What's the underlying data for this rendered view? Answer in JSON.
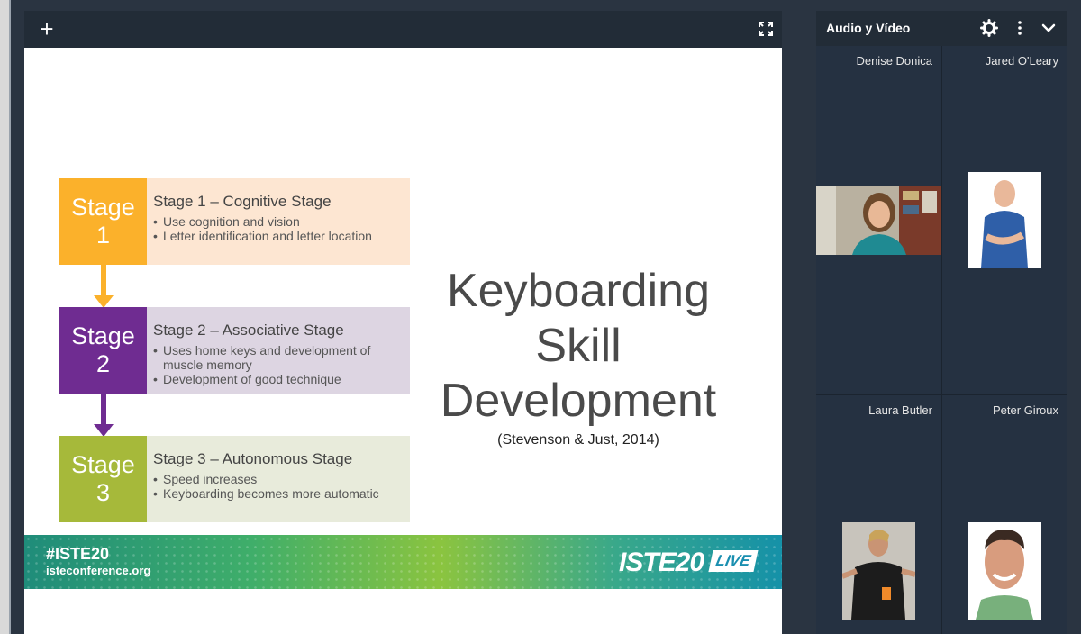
{
  "presentation": {
    "add_label": "+",
    "slide": {
      "stages": [
        {
          "box_line1": "Stage",
          "box_line2": "1",
          "title": "Stage 1 – Cognitive Stage",
          "bullets": [
            "Use cognition and vision",
            "Letter identification and letter location"
          ]
        },
        {
          "box_line1": "Stage",
          "box_line2": "2",
          "title": "Stage 2 – Associative Stage",
          "bullets": [
            "Uses home keys and development of muscle memory",
            "Development of good technique"
          ]
        },
        {
          "box_line1": "Stage",
          "box_line2": "3",
          "title": "Stage 3 – Autonomous Stage",
          "bullets": [
            "Speed increases",
            "Keyboarding becomes more automatic"
          ]
        }
      ],
      "title_lines": [
        "Keyboarding",
        "Skill",
        "Development"
      ],
      "citation": "(Stevenson & Just, 2014)",
      "banner": {
        "hashtag": "#ISTE20",
        "site": "isteconference.org",
        "logo": "ISTE20",
        "live": "LIVE"
      }
    }
  },
  "side_panel": {
    "title": "Audio y Vídeo",
    "participants": [
      {
        "name": "Denise Donica"
      },
      {
        "name": "Jared O'Leary"
      },
      {
        "name": "Laura Butler"
      },
      {
        "name": "Peter Giroux"
      }
    ]
  },
  "colors": {
    "stage1": "#fbb12b",
    "stage1_bg": "#fde6d2",
    "stage2": "#6f2c91",
    "stage2_bg": "#ddd5e2",
    "stage3": "#a6b93a",
    "stage3_bg": "#e8ebdb",
    "panel": "#2e3a48"
  },
  "icons": [
    "plus-icon",
    "fullscreen-icon",
    "gear-icon",
    "more-vertical-icon",
    "chevron-down-icon"
  ]
}
